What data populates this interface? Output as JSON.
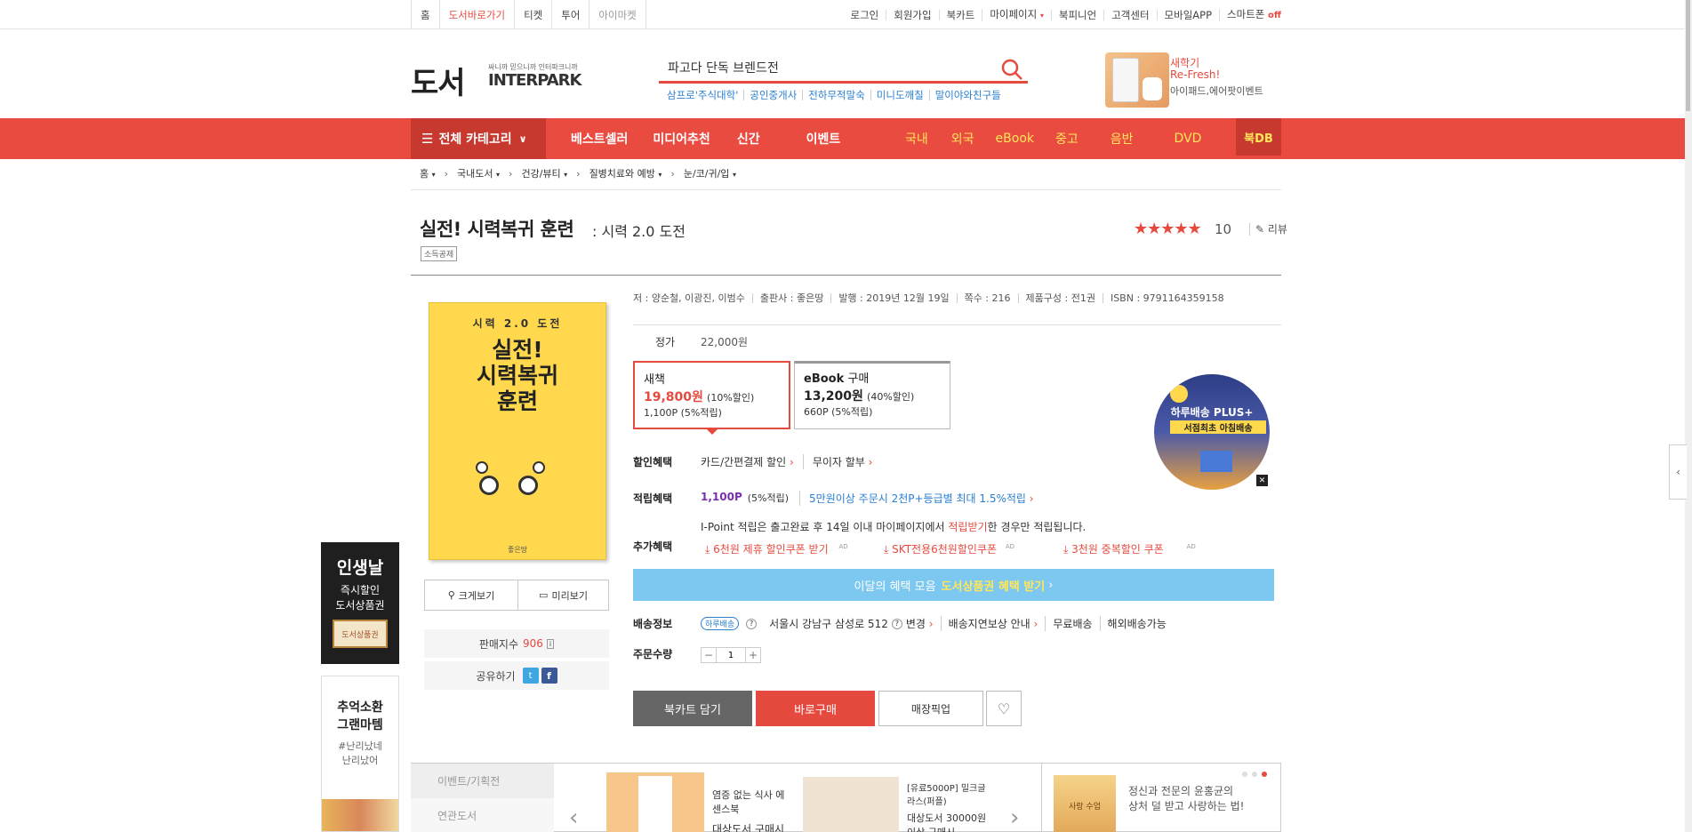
{
  "topnav": {
    "left": [
      "홈",
      "도서바로가기",
      "티켓",
      "투어",
      "아이마켓"
    ],
    "right": [
      "로그인",
      "회원가입",
      "북카트",
      "마이페이지",
      "북피니언",
      "고객센터",
      "모바일APP",
      "스마트폰"
    ],
    "smartphone_status": "off"
  },
  "header": {
    "logo_main": "도서",
    "logo_slogan": "싸니까 믿으니까 인터파크니까",
    "logo_brand": "INTERPARK",
    "search_value": "파고다 단독 브렌드전",
    "hot_keywords": [
      "삼프로'주식대학'",
      "공인중개사",
      "전하무적말숙",
      "미니도깨칠",
      "말이야와친구들"
    ],
    "promo": {
      "line1": "새학기",
      "line2": "Re-Fresh!",
      "line3": "아이패드,에어팟이벤트"
    }
  },
  "mainnav": {
    "all_category": "전체 카테고리",
    "items": [
      "베스트셀러",
      "미디어추천",
      "신간",
      "이벤트"
    ],
    "sub_items": [
      "국내",
      "외국",
      "eBook",
      "중고",
      "음반",
      "DVD"
    ],
    "bookdb": "북DB"
  },
  "breadcrumb": [
    "홈",
    "국내도서",
    "건강/뷰티",
    "질병치료와 예방",
    "눈/코/귀/입"
  ],
  "book": {
    "title": "실전! 시력복귀 훈련",
    "subtitle": ": 시력 2.0 도전",
    "tag": "소득공제",
    "stars": "★★★★★",
    "score": "10",
    "review_label": "리뷰",
    "cover": {
      "top_text": "시력 2.0 도전",
      "title1": "실전!",
      "title2": "시력복귀",
      "title3": "훈련",
      "publisher": "좋은땅"
    },
    "meta": [
      "저 : 양순철, 이광진, 이범수",
      "출판사 : 좋은땅",
      "발행 : 2019년 12월 19일",
      "쪽수 : 216",
      "제품구성 : 전1권",
      "ISBN : 9791164359158"
    ],
    "zoom_label": "크게보기",
    "preview_label": "미리보기",
    "sales_label": "판매지수",
    "sales_value": "906",
    "share_label": "공유하기"
  },
  "price": {
    "label": "정가",
    "value": "22,000원",
    "new": {
      "label": "새책",
      "price": "19,800원",
      "discount": "(10%할인)",
      "points": "1,100P (5%적립)"
    },
    "ebook": {
      "label": "eBook",
      "label_suffix": "구매",
      "price": "13,200원",
      "discount": "(40%할인)",
      "points": "660P (5%적립)"
    }
  },
  "benefits": {
    "discount_label": "할인혜택",
    "discount_items": [
      "카드/간편결제 할인",
      "무이자 할부"
    ],
    "points_label": "적립혜택",
    "points_value": "1,100P",
    "points_rate": "(5%적립)",
    "points_extra": "5만원이상 주문시 2천P+등급별 최대 1.5%적립",
    "ipoint_note_pre": "I-Point 적립은 출고완료 후 14일 이내 마이페이지에서",
    "ipoint_note_link": "적립받기",
    "ipoint_note_post": "한 경우만 적립됩니다.",
    "extra_label": "추가혜택",
    "coupons": [
      "6천원 제휴 할인쿠폰 받기",
      "SKT전용6천원할인쿠폰",
      "3천원 중복할인 쿠폰"
    ],
    "ad_mark": "AD"
  },
  "banner": {
    "text": "이달의 혜택 모음",
    "highlight": "도서상품권 혜택 받기"
  },
  "delivery": {
    "label": "배송정보",
    "badge": "하루배송",
    "address": "서울시 강남구 삼성로 512",
    "change": "변경",
    "items": [
      "배송지연보상 안내",
      "무료배송",
      "해외배송가능"
    ]
  },
  "quantity": {
    "label": "주문수량",
    "value": "1"
  },
  "actions": {
    "cart": "북카트 담기",
    "buy": "바로구매",
    "pickup": "매장픽업"
  },
  "badge": {
    "title": "하루배송 PLUS+",
    "subtitle": "서점최초 아침배송"
  },
  "left_ads": {
    "ad1": [
      "인생날",
      "즉시할인",
      "도서상품권"
    ],
    "ad1_button": "도서상품권",
    "ad2": [
      "추억소환",
      "그랜마템"
    ],
    "ad2_sub": [
      "#난리났네",
      "난리났어"
    ]
  },
  "bottom": {
    "tabs": [
      "이벤트/기획전",
      "연관도서"
    ],
    "item1": [
      "염증 없는 식사 에",
      "센스북",
      "대상도서 구매시"
    ],
    "item2": [
      "[유료5000P] 밀크글",
      "라스(퍼플)",
      "대상도서 30000원",
      "이상 구매시"
    ],
    "side_text": [
      "정신과 전문의 윤홍균의",
      "상처 덜 받고 사랑하는 법!"
    ],
    "side_book_title": "사랑 수업"
  },
  "colors": {
    "accent": "#e64a3f",
    "nav": "#ea4b40",
    "link_blue": "#2a7fd1",
    "banner": "#7dc8f0"
  }
}
